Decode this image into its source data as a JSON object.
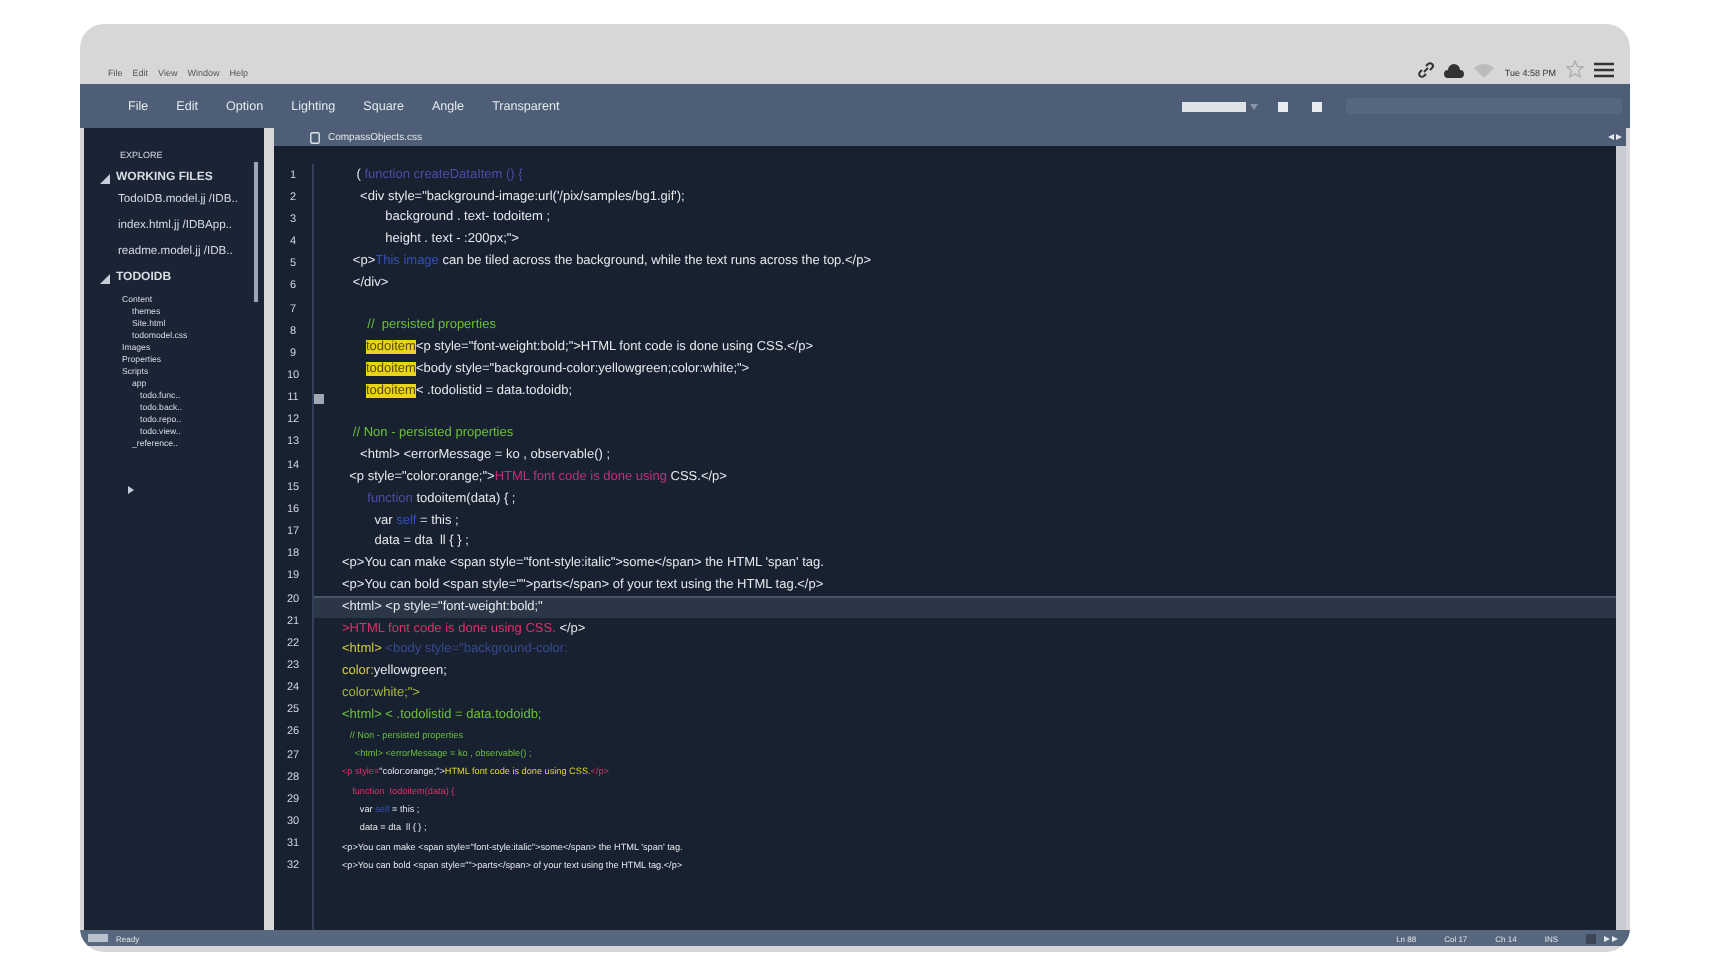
{
  "os_menu": {
    "items": [
      "File",
      "Edit",
      "View",
      "Window",
      "Help"
    ],
    "clock": "Tue 4:58 PM"
  },
  "menu_bar": {
    "items": [
      "File",
      "Edit",
      "Option",
      "Lighting",
      "Square",
      "Angle",
      "Transparent"
    ]
  },
  "sidebar": {
    "title": "EXPLORE",
    "sections": [
      {
        "label": "WORKING FILES",
        "expanded": true,
        "children": [
          {
            "label": "TodoIDB.model.jj  /IDB.."
          },
          {
            "label": "index.html.jj  /IDBApp.."
          },
          {
            "label": "readme.model.jj  /IDB.."
          }
        ]
      },
      {
        "label": "TODOIDB",
        "expanded": true,
        "children": [
          {
            "label": "Content",
            "children": [
              {
                "label": "themes"
              },
              {
                "label": "Site.html"
              },
              {
                "label": "todomodel.css"
              }
            ]
          },
          {
            "label": "Images"
          },
          {
            "label": "Properties"
          },
          {
            "label": "Scripts",
            "children": [
              {
                "label": "app",
                "children": [
                  {
                    "label": "todo.func.."
                  },
                  {
                    "label": "todo.back.."
                  },
                  {
                    "label": "todo.repo.."
                  },
                  {
                    "label": "todo.view.."
                  }
                ]
              },
              {
                "label": "_reference.."
              }
            ]
          }
        ]
      }
    ]
  },
  "editor": {
    "tab": "CompassObjects.css",
    "line_numbers": [
      {
        "n": "1",
        "breakpoint": false
      },
      {
        "n": "2",
        "breakpoint": false
      },
      {
        "n": "3",
        "breakpoint": false
      },
      {
        "n": "4",
        "breakpoint": false
      },
      {
        "n": "5",
        "breakpoint": false
      },
      {
        "n": "6",
        "breakpoint": false
      },
      {
        "n": "7",
        "breakpoint": false
      },
      {
        "n": "8",
        "breakpoint": false
      },
      {
        "n": "9",
        "breakpoint": false
      },
      {
        "n": "10",
        "breakpoint": false
      },
      {
        "n": "11",
        "breakpoint": true
      },
      {
        "n": "12",
        "breakpoint": false
      },
      {
        "n": "13",
        "breakpoint": false
      },
      {
        "n": "14",
        "breakpoint": false
      },
      {
        "n": "15",
        "breakpoint": false
      },
      {
        "n": "16",
        "breakpoint": false
      },
      {
        "n": "17",
        "breakpoint": false
      },
      {
        "n": "18",
        "breakpoint": false
      },
      {
        "n": "19",
        "breakpoint": false
      },
      {
        "n": "20",
        "breakpoint": false
      },
      {
        "n": "21",
        "breakpoint": false
      },
      {
        "n": "22",
        "breakpoint": false
      },
      {
        "n": "23",
        "breakpoint": false
      },
      {
        "n": "24",
        "breakpoint": false
      },
      {
        "n": "25",
        "breakpoint": false
      },
      {
        "n": "26",
        "breakpoint": false
      },
      {
        "n": "27",
        "breakpoint": false
      },
      {
        "n": "28",
        "breakpoint": false
      },
      {
        "n": "29",
        "breakpoint": false
      },
      {
        "n": "30",
        "breakpoint": false
      },
      {
        "n": "31",
        "breakpoint": false
      },
      {
        "n": "32",
        "breakpoint": false
      }
    ],
    "lines": [
      {
        "kind": "normal",
        "current": false,
        "segments": [
          {
            "text": "    ( ",
            "kind": "plain"
          },
          {
            "text": "function createDataItem () {",
            "kind": "keyword"
          }
        ]
      },
      {
        "kind": "normal",
        "current": false,
        "segments": [
          {
            "text": "     <div style=\"background-image:url('/pix/samples/bg1.gif');",
            "kind": "plain"
          }
        ]
      },
      {
        "kind": "normal",
        "current": false,
        "segments": [
          {
            "text": "            background . text- todoitem ;",
            "kind": "plain"
          }
        ]
      },
      {
        "kind": "normal",
        "current": false,
        "segments": [
          {
            "text": "            height . text - :200px;\">",
            "kind": "plain"
          }
        ]
      },
      {
        "kind": "normal",
        "current": false,
        "segments": [
          {
            "text": "   <p>",
            "kind": "plain"
          },
          {
            "text": "This image",
            "kind": "variable"
          },
          {
            "text": " can be tiled across the background, while the text runs across the top.</p>",
            "kind": "plain"
          }
        ]
      },
      {
        "kind": "normal",
        "current": false,
        "segments": [
          {
            "text": "   </div>",
            "kind": "plain"
          }
        ]
      },
      {
        "kind": "normal",
        "current": false
      },
      {
        "kind": "normal",
        "current": false,
        "segments": [
          {
            "text": "       //  persisted properties",
            "kind": "comment"
          }
        ]
      },
      {
        "kind": "normal",
        "current": false,
        "segments": [
          {
            "text": "todoitem",
            "kind": "highlight"
          },
          {
            "text": "<p style=\"font-weight:bold;\">HTML font code is done using CSS.</p>",
            "kind": "plain"
          }
        ]
      },
      {
        "kind": "normal",
        "current": false,
        "segments": [
          {
            "text": "todoitem",
            "kind": "highlight"
          },
          {
            "text": "<body style=\"background-color:yellowgreen;color:white;\">",
            "kind": "plain"
          }
        ]
      },
      {
        "kind": "normal",
        "current": false,
        "segments": [
          {
            "text": "todoitem",
            "kind": "highlight"
          },
          {
            "text": "< .todolistid = data.todoidb;",
            "kind": "plain"
          }
        ]
      },
      {
        "kind": "normal",
        "current": false
      },
      {
        "kind": "normal",
        "current": false,
        "segments": [
          {
            "text": "   // Non - persisted properties",
            "kind": "comment"
          }
        ]
      },
      {
        "kind": "normal",
        "current": false,
        "segments": [
          {
            "text": "     <html> <errorMessage = ko , observable() ;",
            "kind": "plain"
          }
        ]
      },
      {
        "kind": "normal",
        "current": false,
        "segments": [
          {
            "text": "  <p style=\"color:orange;\">",
            "kind": "plain"
          },
          {
            "text": "HTML font code is done using",
            "kind": "markup"
          },
          {
            "text": " CSS.</p>",
            "kind": "plain"
          }
        ]
      },
      {
        "kind": "normal",
        "current": false,
        "segments": [
          {
            "text": "       function",
            "kind": "keyword"
          },
          {
            "text": " todoitem(data) { ;",
            "kind": "plain"
          }
        ]
      },
      {
        "kind": "normal",
        "current": false,
        "segments": [
          {
            "text": "         var ",
            "kind": "plain"
          },
          {
            "text": "self",
            "kind": "variable"
          },
          {
            "text": " = this ;",
            "kind": "plain"
          }
        ]
      },
      {
        "kind": "normal",
        "current": false,
        "segments": [
          {
            "text": "         data = dta  ll { } ;",
            "kind": "plain"
          }
        ]
      },
      {
        "kind": "normal",
        "current": false,
        "segments": [
          {
            "text": "<p>You can make <span style=\"font-style:italic\">some</span> the HTML 'span' tag.",
            "kind": "plain"
          }
        ]
      },
      {
        "kind": "normal",
        "current": false,
        "segments": [
          {
            "text": "<p>You can bold <span style=\"\">parts</span> of your text using the HTML tag.</p>",
            "kind": "plain"
          }
        ]
      },
      {
        "kind": "normal",
        "current": true,
        "segments": [
          {
            "text": "<html> <p style=\"font-weight:bold;\"",
            "kind": "plain"
          }
        ]
      },
      {
        "kind": "normal",
        "current": false,
        "segments": [
          {
            "text": ">HTML font code is done using CSS.",
            "kind": "error"
          },
          {
            "text": " </p>",
            "kind": "plain"
          }
        ]
      },
      {
        "kind": "normal",
        "current": false,
        "segments": [
          {
            "text": "<html>",
            "kind": "attribute"
          },
          {
            "text": " <body style=\"background-color:",
            "kind": "dim"
          }
        ]
      },
      {
        "kind": "normal",
        "current": false,
        "segments": [
          {
            "text": "color:",
            "kind": "attribute"
          },
          {
            "text": "yellowgreen;",
            "kind": "plain"
          }
        ]
      },
      {
        "kind": "normal",
        "current": false,
        "segments": [
          {
            "text": "color:white;\">",
            "kind": "value"
          }
        ]
      },
      {
        "kind": "normal",
        "current": false,
        "segments": [
          {
            "text": "<html> < .todolistid = data.todoidb;",
            "kind": "comment"
          }
        ]
      },
      {
        "kind": "small",
        "current": false,
        "segments": [
          {
            "text": "   // Non - persisted properties",
            "kind": "comment"
          }
        ]
      },
      {
        "kind": "small",
        "current": false,
        "segments": [
          {
            "text": "     <html> <errorMessage = ko , observable() ;",
            "kind": "comment"
          }
        ]
      },
      {
        "kind": "small",
        "current": false,
        "segments": [
          {
            "text": "<p style=",
            "kind": "error"
          },
          {
            "text": "\"color:orange;\">",
            "kind": "plain"
          },
          {
            "text": "HTML font code is done using CSS.",
            "kind": "string"
          },
          {
            "text": "</p>",
            "kind": "error"
          }
        ]
      },
      {
        "kind": "small",
        "current": false,
        "segments": [
          {
            "text": "    function  todoitem(data) {",
            "kind": "error"
          }
        ]
      },
      {
        "kind": "small",
        "current": false,
        "segments": [
          {
            "text": "       var ",
            "kind": "plain"
          },
          {
            "text": "self",
            "kind": "variable"
          },
          {
            "text": " = this ;",
            "kind": "plain"
          }
        ]
      },
      {
        "kind": "small",
        "current": false,
        "segments": [
          {
            "text": "       data = dta  ll { } ;",
            "kind": "plain"
          }
        ]
      },
      {
        "kind": "small",
        "current": false,
        "segments": [
          {
            "text": "<p>You can make <span style=\"font-style:italic\">some</span> the HTML 'span' tag.",
            "kind": "plain"
          }
        ]
      },
      {
        "kind": "small",
        "current": false,
        "segments": [
          {
            "text": "<p>You can bold <span style=\"\">parts</span> of your text using the HTML tag.</p>",
            "kind": "plain"
          }
        ]
      }
    ]
  },
  "status_bar": {
    "state": "Ready",
    "fields": [
      "Ln 88",
      "Col 17",
      "Ch 14",
      "INS"
    ]
  }
}
